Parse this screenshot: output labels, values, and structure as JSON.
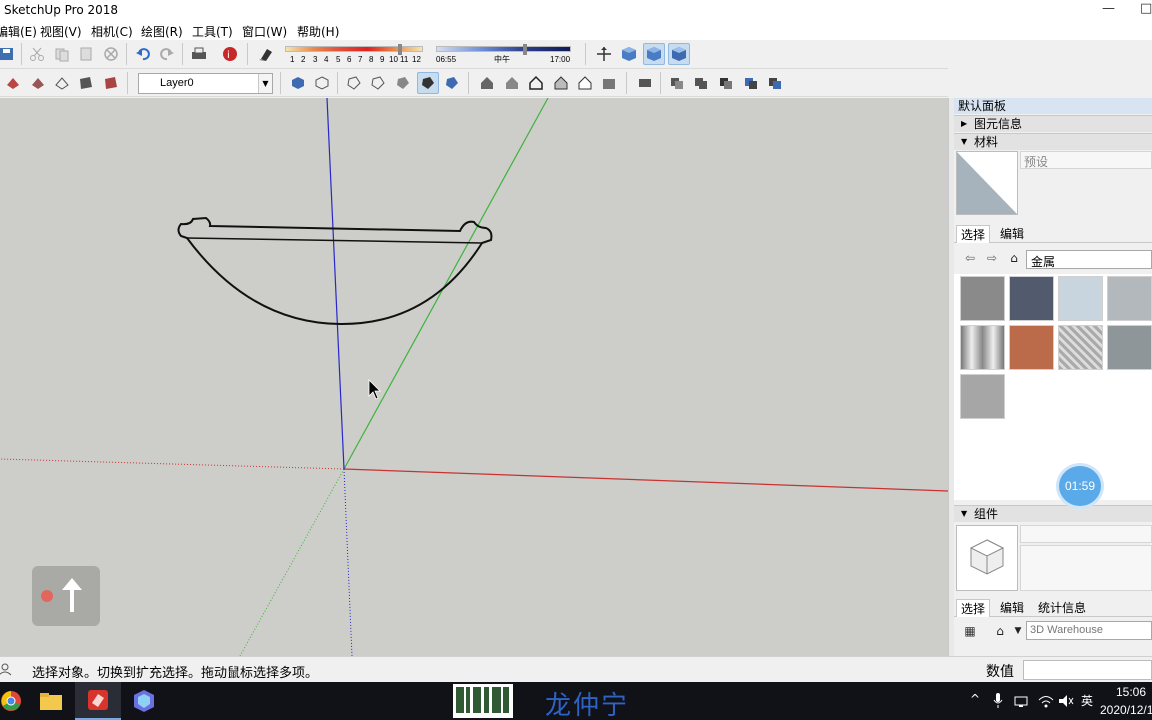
{
  "window": {
    "title": "SketchUp Pro 2018"
  },
  "menu": [
    "编辑(E)",
    "视图(V)",
    "相机(C)",
    "绘图(R)",
    "工具(T)",
    "窗口(W)",
    "帮助(H)"
  ],
  "shadow_settings": {
    "months": [
      "1",
      "2",
      "3",
      "4",
      "5",
      "6",
      "7",
      "8",
      "9",
      "10",
      "11",
      "12"
    ],
    "time_start": "06:55",
    "time_mid": "中午",
    "time_end": "17:00"
  },
  "layer": {
    "current": "Layer0",
    "check": "✓"
  },
  "tray_panel": {
    "title": "默认面板",
    "entity_info": "图元信息",
    "materials": {
      "header": "材料",
      "name_placeholder": "预设",
      "tabs": [
        "选择",
        "编辑"
      ],
      "category": "金属",
      "swatches": [
        {
          "name": "metal-swatch-1",
          "color": "#8a8a8a"
        },
        {
          "name": "metal-swatch-2",
          "color": "#525a6e"
        },
        {
          "name": "metal-swatch-3",
          "color": "#c9d5de"
        },
        {
          "name": "metal-swatch-4",
          "color": "#b2b8bc"
        },
        {
          "name": "metal-swatch-5",
          "color": "#bcbcbc"
        },
        {
          "name": "metal-swatch-6",
          "color": "#bb6a4a"
        },
        {
          "name": "metal-swatch-7",
          "color": "#b0b0b0"
        },
        {
          "name": "metal-swatch-8",
          "color": "#8e969a"
        },
        {
          "name": "metal-swatch-9",
          "color": "#a6a6a6"
        }
      ]
    },
    "components": {
      "header": "组件",
      "tabs": [
        "选择",
        "编辑",
        "统计信息"
      ],
      "warehouse_placeholder": "3D Warehouse"
    }
  },
  "recording_timer": "01:59",
  "status": {
    "hint": "选择对象。切换到扩充选择。拖动鼠标选择多项。",
    "measurements_label": "数值"
  },
  "taskbar": {
    "brand": "龙仲宁",
    "ime": "英",
    "time": "15:06",
    "date": "2020/12/1"
  },
  "colors": {
    "viewport_bg": "#cdcdc9",
    "axis_red": "#c83232",
    "axis_green": "#3cb43c",
    "axis_blue": "#2828c8",
    "accent": "#d9e4f2"
  }
}
